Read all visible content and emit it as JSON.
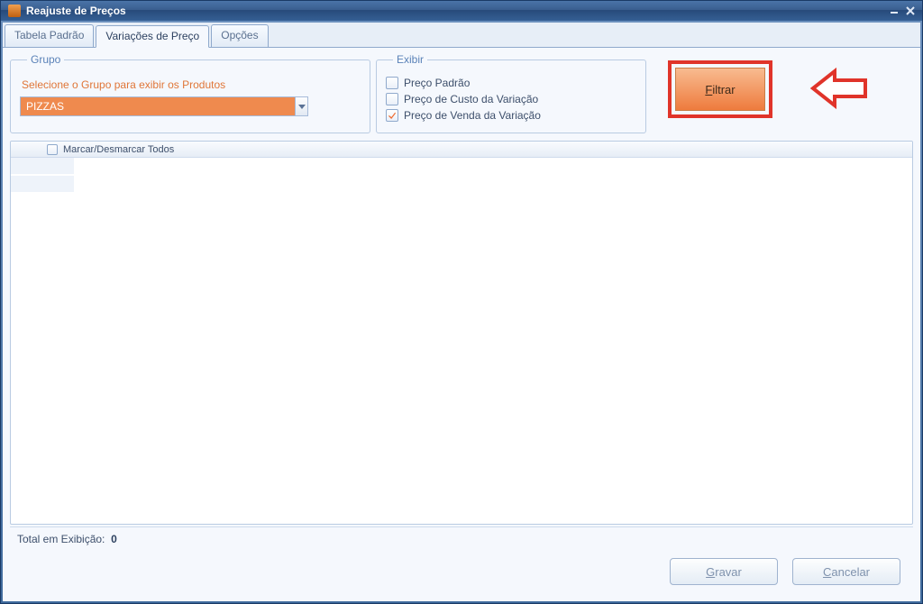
{
  "window": {
    "title": "Reajuste de Preços"
  },
  "tabs": [
    {
      "label": "Tabela Padrão"
    },
    {
      "label": "Variações de Preço"
    },
    {
      "label": "Opções"
    }
  ],
  "active_tab_index": 1,
  "grupo": {
    "legend": "Grupo",
    "instruction": "Selecione o Grupo para exibir os Produtos",
    "selected": "PIZZAS"
  },
  "exibir": {
    "legend": "Exibir",
    "options": [
      {
        "label": "Preço Padrão",
        "checked": false
      },
      {
        "label": "Preço de Custo da Variação",
        "checked": false
      },
      {
        "label": "Preço de Venda da Variação",
        "checked": true
      }
    ]
  },
  "filter_button": "Filtrar",
  "grid": {
    "mark_all_label": "Marcar/Desmarcar Todos",
    "mark_all_checked": false
  },
  "footer": {
    "total_label": "Total em Exibição:",
    "total_value": "0"
  },
  "buttons": {
    "save_prefix": "G",
    "save_rest": "ravar",
    "cancel_prefix": "C",
    "cancel_rest": "ancelar"
  },
  "colors": {
    "accent_orange": "#ef8a4e",
    "annotation_red": "#e0342a"
  }
}
